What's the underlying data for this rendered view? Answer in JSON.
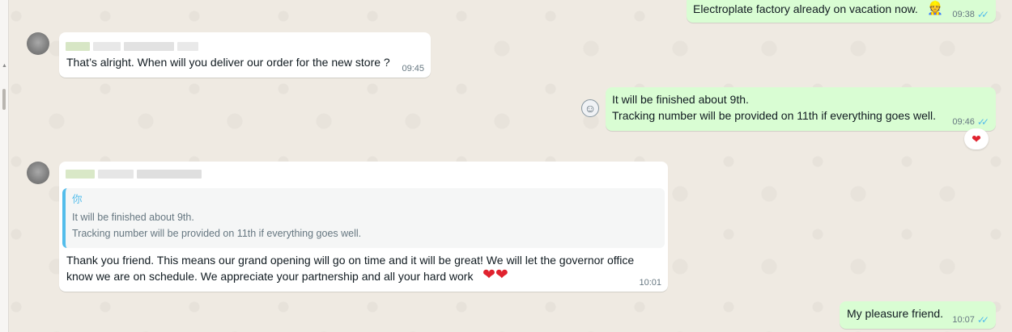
{
  "messages": [
    {
      "text": "Electroplate factory already on vacation now.",
      "emoji": "👷",
      "time": "09:38",
      "status": "read"
    },
    {
      "text": "That’s alright. When will you deliver our order for the new store ?",
      "time": "09:45"
    },
    {
      "lines": [
        "It will be finished about 9th.",
        "Tracking number will be provided on 11th if everything goes well."
      ],
      "time": "09:46",
      "status": "read",
      "reaction": "❤"
    },
    {
      "quote": {
        "author": "你",
        "lines": [
          "It will be finished about 9th.",
          "Tracking number will be provided on 11th if everything goes well."
        ]
      },
      "lines": [
        "Thank you friend. This means our grand opening will go on time and it will be great! We will let the governor office",
        "know we are on schedule. We appreciate your partnership and all your hard work"
      ],
      "hearts": "❤❤",
      "time": "10:01"
    },
    {
      "text": "My pleasure friend.",
      "time": "10:07",
      "status": "read"
    }
  ],
  "icons": {
    "read_ticks": "✓✓",
    "emoji_button": "☺",
    "scroll_up": "▲"
  },
  "colors": {
    "chat_bg": "#efeae2",
    "outgoing_bubble": "#d9fdd3",
    "incoming_bubble": "#ffffff",
    "read_ticks": "#53bdeb",
    "quote_accent": "#53bdeb",
    "heart": "#e0222e"
  }
}
